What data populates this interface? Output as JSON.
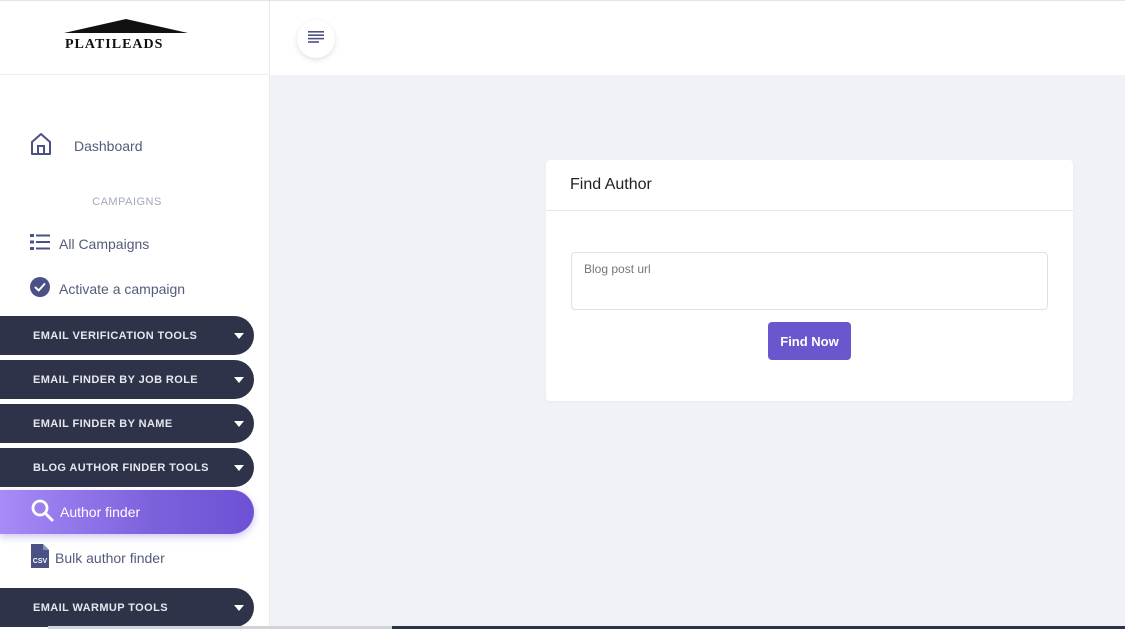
{
  "brand": {
    "logo_text": "PLATILEADS"
  },
  "sidebar": {
    "dashboard_label": "Dashboard",
    "section_title": "CAMPAIGNS",
    "all_campaigns_label": "All Campaigns",
    "activate_campaign_label": "Activate a campaign",
    "groups": [
      {
        "label": "EMAIL VERIFICATION TOOLS"
      },
      {
        "label": "EMAIL FINDER BY JOB ROLE"
      },
      {
        "label": "EMAIL FINDER BY NAME"
      },
      {
        "label": "BLOG AUTHOR FINDER TOOLS"
      },
      {
        "label": "EMAIL WARMUP TOOLS"
      }
    ],
    "active_item_label": "Author finder",
    "bulk_author_label": "Bulk author finder",
    "csv_badge": "CSV"
  },
  "card": {
    "title": "Find Author",
    "input_placeholder": "Blog post url",
    "button_label": "Find Now"
  },
  "colors": {
    "sidebar_pill": "#2f3349",
    "accent": "#6a56cd",
    "active_gradient_start": "#a78bf7",
    "icon": "#4b5085",
    "background": "#f1f2f7"
  },
  "icons": {
    "dashboard": "home-icon",
    "all_campaigns": "list-icon",
    "activate": "check-circle-icon",
    "author_finder": "search-icon",
    "bulk": "csv-file-icon",
    "menu": "hamburger-icon"
  }
}
